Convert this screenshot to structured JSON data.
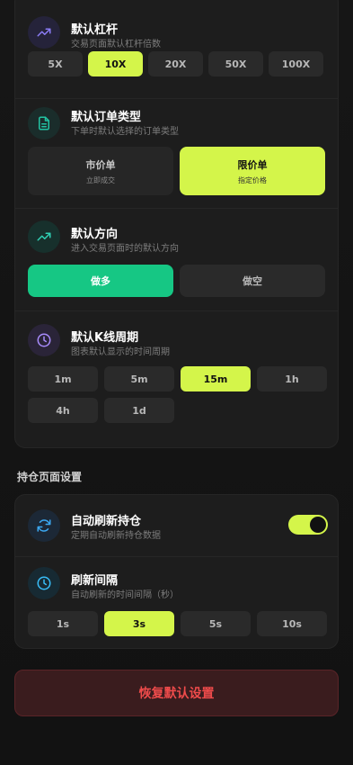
{
  "colors": {
    "accent": "#d4f54a",
    "long": "#16c784",
    "danger": "#ef4b4b"
  },
  "leverage": {
    "title": "默认杠杆",
    "desc": "交易页面默认杠杆倍数",
    "icon": "trend-up-icon",
    "options": [
      {
        "label": "5X",
        "selected": false
      },
      {
        "label": "10X",
        "selected": true
      },
      {
        "label": "20X",
        "selected": false
      },
      {
        "label": "50X",
        "selected": false
      },
      {
        "label": "100X",
        "selected": false
      }
    ]
  },
  "order_type": {
    "title": "默认订单类型",
    "desc": "下单时默认选择的订单类型",
    "icon": "document-icon",
    "options": [
      {
        "label": "市价单",
        "sub": "立即成交",
        "selected": false
      },
      {
        "label": "限价单",
        "sub": "指定价格",
        "selected": true
      }
    ]
  },
  "direction": {
    "title": "默认方向",
    "desc": "进入交易页面时的默认方向",
    "icon": "trend-up-icon",
    "options": [
      {
        "label": "做多",
        "selected": true
      },
      {
        "label": "做空",
        "selected": false
      }
    ]
  },
  "kline": {
    "title": "默认K线周期",
    "desc": "图表默认显示的时间周期",
    "icon": "clock-icon",
    "options": [
      {
        "label": "1m",
        "selected": false
      },
      {
        "label": "5m",
        "selected": false
      },
      {
        "label": "15m",
        "selected": true
      },
      {
        "label": "1h",
        "selected": false
      },
      {
        "label": "4h",
        "selected": false
      },
      {
        "label": "1d",
        "selected": false
      }
    ]
  },
  "position_settings": {
    "header": "持仓页面设置",
    "auto_refresh": {
      "title": "自动刷新持仓",
      "desc": "定期自动刷新持仓数据",
      "icon": "refresh-icon",
      "enabled": true
    },
    "interval": {
      "title": "刷新间隔",
      "desc": "自动刷新的时间间隔（秒）",
      "icon": "clock-icon",
      "options": [
        {
          "label": "1s",
          "selected": false
        },
        {
          "label": "3s",
          "selected": true
        },
        {
          "label": "5s",
          "selected": false
        },
        {
          "label": "10s",
          "selected": false
        }
      ]
    }
  },
  "reset_label": "恢复默认设置"
}
